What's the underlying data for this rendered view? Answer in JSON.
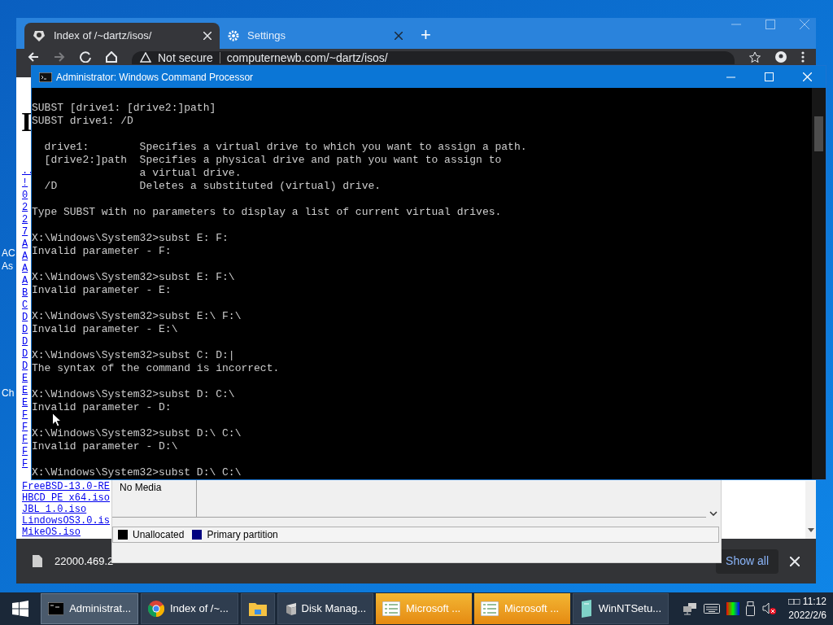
{
  "desktop": {
    "icon_labels": [
      "AC",
      "As",
      "Ch"
    ]
  },
  "browser": {
    "tabs": [
      {
        "title": "Index of /~dartz/isos/",
        "kind": "site",
        "selected": true
      },
      {
        "title": "Settings",
        "kind": "settings",
        "selected": false
      }
    ],
    "new_tab": "+",
    "address": {
      "security": "Not secure",
      "url": "computernewb.com/~dartz/isos/"
    },
    "page": {
      "heading": "I",
      "link_fragments": [
        "..",
        "!",
        "0",
        "2",
        "2",
        "7",
        "A",
        "A",
        "A",
        "A",
        "B",
        "C",
        "D",
        "D",
        "D",
        "D",
        "D",
        "E",
        "E",
        "E",
        "F",
        "F",
        "F",
        "F",
        "F"
      ],
      "links": [
        "FreeBSD-13.0-RE",
        "HBCD_PE_x64.iso",
        "JBL_1.0.iso",
        "LindowsOS3.0.is",
        "MikeOS.iso"
      ]
    },
    "downloads": {
      "items": [
        "22000.469.2"
      ],
      "show_all": "Show all"
    }
  },
  "cmd": {
    "title": "Administrator: Windows Command Processor",
    "blocks": [
      [
        "SUBST [drive1: [drive2:]path]",
        "SUBST drive1: /D"
      ],
      [
        "  drive1:        Specifies a virtual drive to which you want to assign a path.",
        "  [drive2:]path  Specifies a physical drive and path you want to assign to",
        "                 a virtual drive.",
        "  /D             Deletes a substituted (virtual) drive."
      ],
      [
        "Type SUBST with no parameters to display a list of current virtual drives."
      ],
      [
        "X:\\Windows\\System32>subst E: F:",
        "Invalid parameter - F:"
      ],
      [
        "X:\\Windows\\System32>subst E: F:\\",
        "Invalid parameter - E:"
      ],
      [
        "X:\\Windows\\System32>subst E:\\ F:\\",
        "Invalid parameter - E:\\"
      ],
      [
        "X:\\Windows\\System32>subst C: D:|",
        "The syntax of the command is incorrect."
      ],
      [
        "X:\\Windows\\System32>subst D: C:\\",
        "Invalid parameter - D:"
      ],
      [
        "X:\\Windows\\System32>subst D:\\ C:\\",
        "Invalid parameter - D:\\"
      ],
      [
        "X:\\Windows\\System32>subst D:\\ C:\\"
      ]
    ]
  },
  "disk_management": {
    "media": "No Media",
    "legend": [
      {
        "label": "Unallocated",
        "color": "#000000"
      },
      {
        "label": "Primary partition",
        "color": "#000080"
      }
    ]
  },
  "taskbar": {
    "items": [
      {
        "label": "Administrat...",
        "kind": "console",
        "selected": true,
        "flashing": false
      },
      {
        "label": "Index of /~...",
        "kind": "browser",
        "selected": false,
        "flashing": false
      },
      {
        "kind": "folder",
        "selected": false,
        "flashing": false
      },
      {
        "label": "Disk Manag...",
        "kind": "disk",
        "selected": false,
        "flashing": false
      },
      {
        "label": "Microsoft ...",
        "kind": "sheet",
        "selected": false,
        "flashing": true
      },
      {
        "label": "Microsoft ...",
        "kind": "sheet",
        "selected": false,
        "flashing": true
      },
      {
        "label": "WinNTSetu...",
        "kind": "setup",
        "selected": false,
        "flashing": false
      }
    ],
    "clock": {
      "time": "□□ 11:12",
      "date": "2022/2/6"
    }
  }
}
